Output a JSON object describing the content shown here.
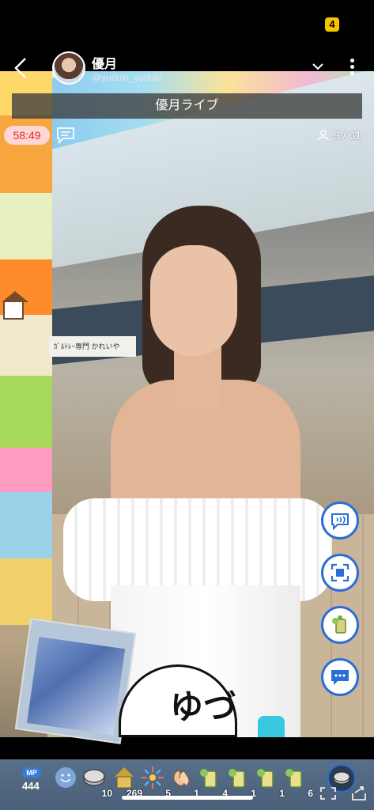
{
  "status": {
    "battery_label": "4"
  },
  "header": {
    "streamer_name": "優月",
    "streamer_id": "@yuduki_yuduki"
  },
  "live_title": "優月ライブ",
  "timer": "58:49",
  "viewers": "9 / 61",
  "scene": {
    "shop_sign": "ｶﾞﾙﾄﾚｰ専門 かれいや",
    "fan_text": "ゆづ"
  },
  "gift_bar": {
    "mp_label": "MP",
    "mp_value": "444",
    "items": [
      {
        "icon": "smile-icon",
        "count": ""
      },
      {
        "icon": "coin-icon",
        "count": "10"
      },
      {
        "icon": "tower-icon",
        "count": "269"
      },
      {
        "icon": "firework-icon",
        "count": "5"
      },
      {
        "icon": "clap-icon",
        "count": "1"
      },
      {
        "icon": "drink-icon",
        "count": "4"
      },
      {
        "icon": "drink-icon",
        "count": "1"
      },
      {
        "icon": "drink-icon",
        "count": "1"
      },
      {
        "icon": "drink-icon",
        "count": "6"
      }
    ]
  },
  "colors": {
    "accent": "#2b6fd6",
    "timer_bg": "#ffd6d6",
    "timer_text": "#e02a2a",
    "gift_bar": "#52677f"
  }
}
